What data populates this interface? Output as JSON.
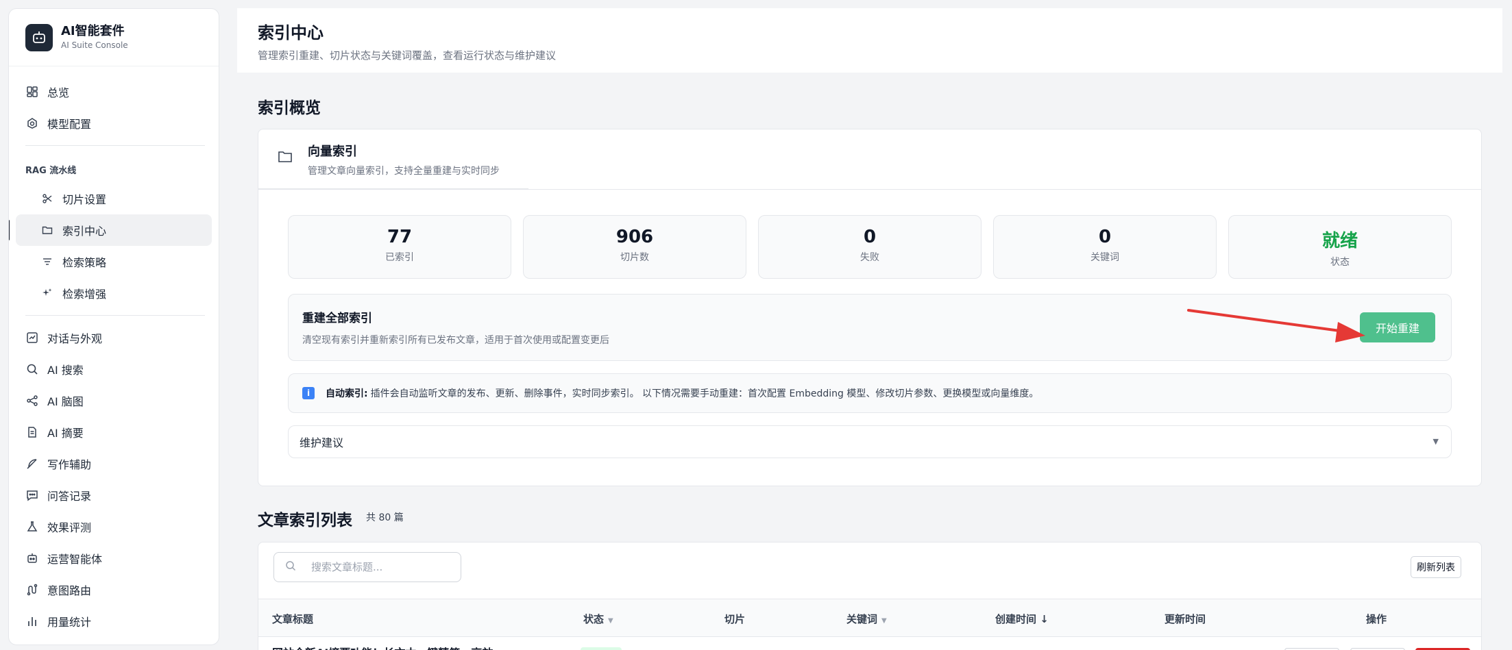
{
  "brand": {
    "title": "AI智能套件",
    "subtitle": "AI Suite Console"
  },
  "sidebar": {
    "top_items": [
      {
        "label": "总览",
        "icon": "dashboard-icon"
      },
      {
        "label": "模型配置",
        "icon": "model-icon"
      }
    ],
    "group_label": "RAG 流水线",
    "rag_items": [
      {
        "label": "切片设置",
        "icon": "scissors-icon"
      },
      {
        "label": "索引中心",
        "icon": "folder-icon",
        "active": true
      },
      {
        "label": "检索策略",
        "icon": "filter-icon"
      },
      {
        "label": "检索增强",
        "icon": "sparkle-icon"
      }
    ],
    "bottom_items": [
      {
        "label": "对话与外观",
        "icon": "chat-chart-icon"
      },
      {
        "label": "AI 搜索",
        "icon": "search-icon"
      },
      {
        "label": "AI 脑图",
        "icon": "mindmap-icon"
      },
      {
        "label": "AI 摘要",
        "icon": "document-icon"
      },
      {
        "label": "写作辅助",
        "icon": "feather-icon"
      },
      {
        "label": "问答记录",
        "icon": "message-icon"
      },
      {
        "label": "效果评测",
        "icon": "flask-icon"
      },
      {
        "label": "运营智能体",
        "icon": "robot-icon"
      },
      {
        "label": "意图路由",
        "icon": "route-icon"
      },
      {
        "label": "用量统计",
        "icon": "bar-chart-icon"
      }
    ]
  },
  "header": {
    "title": "索引中心",
    "subtitle": "管理索引重建、切片状态与关键词覆盖，查看运行状态与维护建议"
  },
  "overview": {
    "section_title": "索引概览",
    "card_title": "向量索引",
    "card_subtitle": "管理文章向量索引，支持全量重建与实时同步",
    "stats": [
      {
        "value": "77",
        "label": "已索引"
      },
      {
        "value": "906",
        "label": "切片数"
      },
      {
        "value": "0",
        "label": "失败"
      },
      {
        "value": "0",
        "label": "关键词"
      },
      {
        "value": "就绪",
        "label": "状态"
      }
    ],
    "rebuild": {
      "title": "重建全部索引",
      "desc": "清空现有索引并重新索引所有已发布文章，适用于首次使用或配置变更后",
      "button": "开始重建",
      "button_color": "#4fc08d"
    },
    "info": {
      "label": "自动索引:",
      "text": "插件会自动监听文章的发布、更新、删除事件，实时同步索引。 以下情况需要手动重建：首次配置 Embedding 模型、修改切片参数、更换模型或向量维度。"
    },
    "maintenance": "维护建议"
  },
  "article_list": {
    "section_title": "文章索引列表",
    "count": "共 80 篇",
    "search_placeholder": "搜索文章标题...",
    "refresh_button": "刷新列表",
    "columns": [
      {
        "label": "文章标题"
      },
      {
        "label": "状态",
        "sort": "▼"
      },
      {
        "label": "切片"
      },
      {
        "label": "关键词",
        "sort": "▼"
      },
      {
        "label": "创建时间 ↓"
      },
      {
        "label": "更新时间"
      },
      {
        "label": "操作"
      }
    ],
    "rows": [
      {
        "title": "网站全新AI摘要功能！长文本一键精简，高效"
      }
    ]
  },
  "colors": {
    "accent": "#4fc08d",
    "ready": "#16a34a",
    "annotation_arrow": "#e53935"
  }
}
